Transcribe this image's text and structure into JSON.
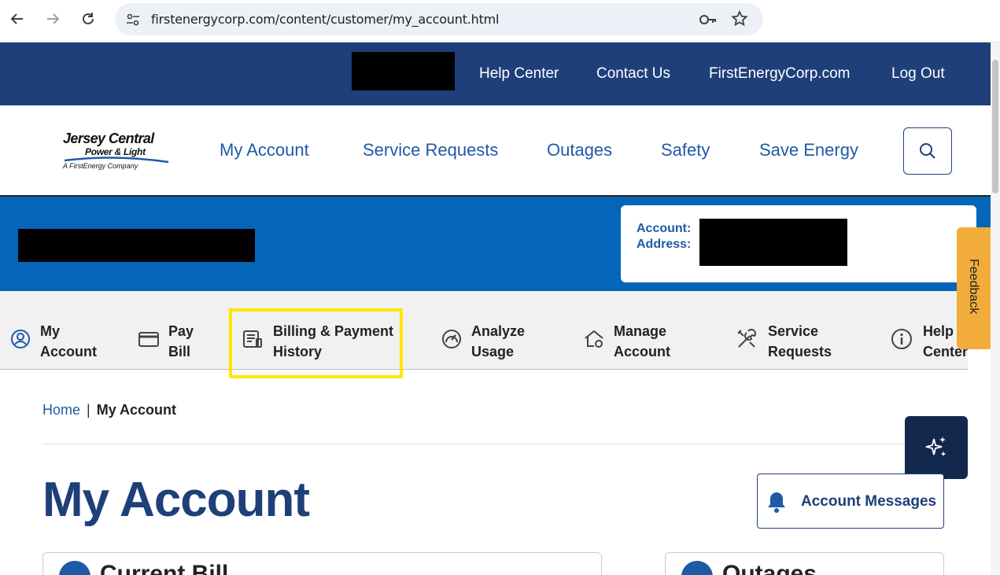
{
  "browser": {
    "url": "firstenergycorp.com/content/customer/my_account.html"
  },
  "utility_bar": {
    "links": [
      "Help Center",
      "Contact Us",
      "FirstEnergyCorp.com",
      "Log Out"
    ]
  },
  "logo": {
    "line1": "Jersey Central",
    "line2": "Power & Light",
    "line3": "A FirstEnergy Company"
  },
  "main_nav": {
    "links": [
      "My Account",
      "Service Requests",
      "Outages",
      "Safety",
      "Save Energy"
    ]
  },
  "account_card": {
    "account_label": "Account:",
    "address_label": "Address:"
  },
  "feedback": {
    "label": "Feedback"
  },
  "sub_nav": {
    "items": [
      {
        "line1": "My",
        "line2": "Account",
        "icon": "user-circle-icon"
      },
      {
        "line1": "Pay",
        "line2": "Bill",
        "icon": "credit-card-icon"
      },
      {
        "line1": "Billing & Payment",
        "line2": "History",
        "icon": "bill-history-icon"
      },
      {
        "line1": "Analyze",
        "line2": "Usage",
        "icon": "gauge-icon"
      },
      {
        "line1": "Manage",
        "line2": "Account",
        "icon": "home-gear-icon"
      },
      {
        "line1": "Service",
        "line2": "Requests",
        "icon": "tools-icon"
      },
      {
        "line1": "Help",
        "line2": "Center",
        "icon": "info-icon"
      }
    ]
  },
  "breadcrumb": {
    "home": "Home",
    "separator": "|",
    "current": "My Account"
  },
  "page": {
    "title": "My Account",
    "messages_button": "Account Messages"
  },
  "cards": {
    "current_bill": "Current Bill",
    "outages": "Outages"
  },
  "colors": {
    "navy": "#1e3f7a",
    "link_blue": "#1f5aa6",
    "banner_blue": "#0565b8",
    "feedback_orange": "#f2ac3c",
    "highlight_yellow": "#ffe600"
  }
}
